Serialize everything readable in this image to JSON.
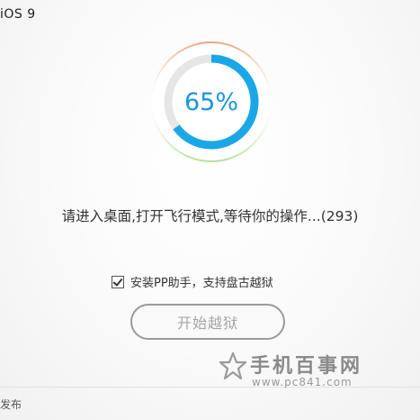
{
  "window": {
    "title": "iOS 9"
  },
  "progress": {
    "value": 0.65,
    "label": "65%",
    "colors": {
      "arc": "#1aa7e8",
      "track": "#e6e6e6",
      "glow_top": "#f0a882",
      "glow_bottom": "#b6e29a"
    }
  },
  "status": {
    "message": "请进入桌面,打开飞行模式,等待你的操作...(293)"
  },
  "option": {
    "checked": true,
    "label": "安装PP助手，支持盘古越狱"
  },
  "actions": {
    "start_label": "开始越狱"
  },
  "footer": {
    "text": "发布"
  },
  "watermark": {
    "title": "手机百事网",
    "url": "www.pc841.com"
  }
}
